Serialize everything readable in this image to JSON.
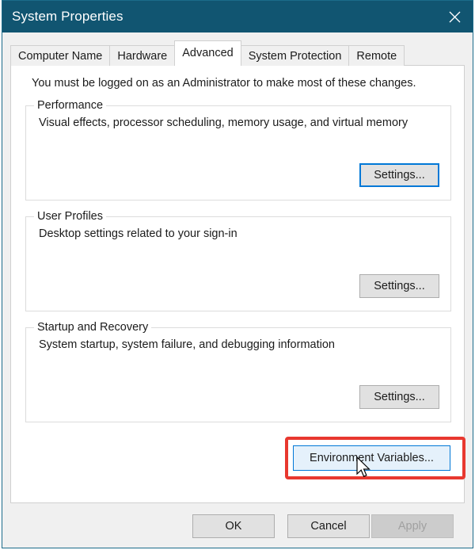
{
  "window": {
    "title": "System Properties",
    "close_icon": "close-x-icon",
    "accent_titlebar_color": "#115571",
    "focus_color": "#0078d7",
    "annotation_color": "#e8382f"
  },
  "tabs": [
    {
      "label": "Computer Name",
      "active": false
    },
    {
      "label": "Hardware",
      "active": false
    },
    {
      "label": "Advanced",
      "active": true
    },
    {
      "label": "System Protection",
      "active": false
    },
    {
      "label": "Remote",
      "active": false
    }
  ],
  "page": {
    "admin_note": "You must be logged on as an Administrator to make most of these changes.",
    "groups": [
      {
        "legend": "Performance",
        "description": "Visual effects, processor scheduling, memory usage, and virtual memory",
        "button_label": "Settings...",
        "button_state": "focused"
      },
      {
        "legend": "User Profiles",
        "description": "Desktop settings related to your sign-in",
        "button_label": "Settings...",
        "button_state": "normal"
      },
      {
        "legend": "Startup and Recovery",
        "description": "System startup, system failure, and debugging information",
        "button_label": "Settings...",
        "button_state": "normal"
      }
    ],
    "environment_variables_button": {
      "label": "Environment Variables...",
      "state": "hover",
      "highlighted": true
    },
    "cursor_icon": "mouse-pointer-icon"
  },
  "footer": {
    "ok_label": "OK",
    "cancel_label": "Cancel",
    "apply_label": "Apply",
    "apply_disabled": true
  }
}
